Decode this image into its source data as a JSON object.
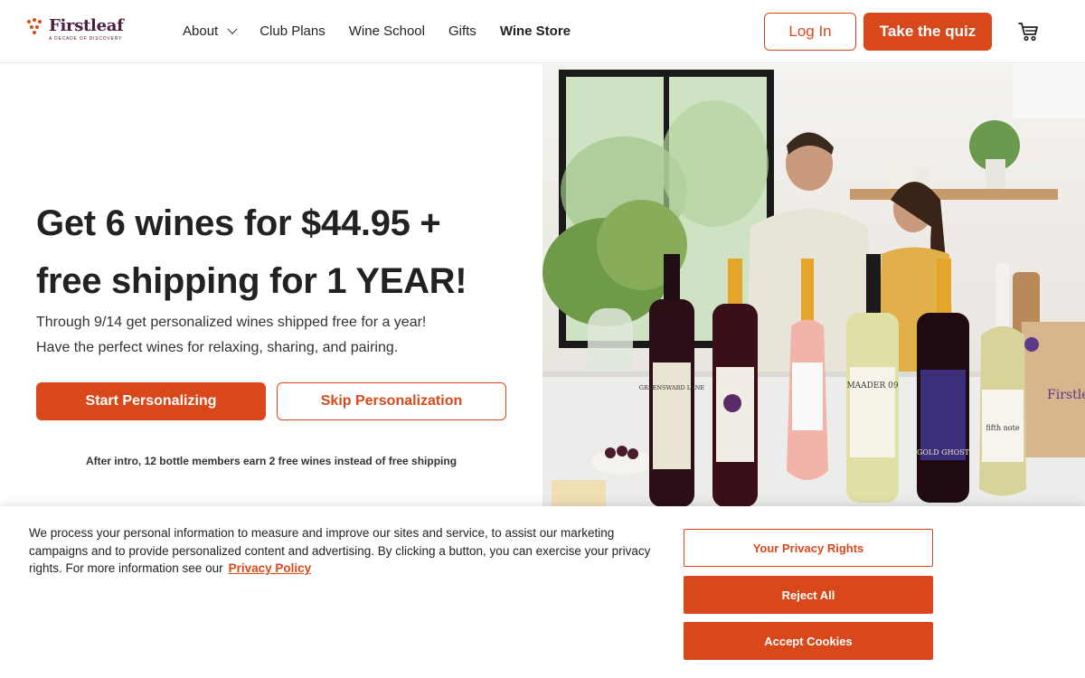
{
  "brand": {
    "name": "Firstleaf",
    "tagline": "A DECADE OF DISCOVERY",
    "accent": "#d9481a",
    "logo_color": "#4b1d3f"
  },
  "nav": {
    "items": [
      {
        "label": "About",
        "has_dropdown": true
      },
      {
        "label": "Club Plans"
      },
      {
        "label": "Wine School"
      },
      {
        "label": "Gifts"
      },
      {
        "label": "Wine Store"
      }
    ],
    "login_label": "Log In",
    "quiz_label": "Take the quiz",
    "cart_icon": "cart-icon"
  },
  "hero": {
    "title_line1": "Get 6 wines for $44.95 +",
    "title_line2": "free shipping for 1 YEAR!",
    "sub_line1": "Through 9/14 get personalized wines shipped free for a year!",
    "sub_line2": "Have the perfect wines for relaxing, sharing, and pairing.",
    "start_label": "Start Personalizing",
    "skip_label": "Skip Personalization",
    "note": "After intro, 12 bottle members earn 2 free wines instead of free shipping",
    "image": {
      "bottle_labels": [
        "GREENSWARD LANE",
        "MAADER 09",
        "GOLD GHOST",
        "fifth note"
      ],
      "box_text": "Firstle"
    }
  },
  "cookie": {
    "text": "We process your personal information to measure and improve our sites and service, to assist our marketing campaigns and to provide personalized content and advertising. By clicking a button, you can exercise your privacy rights. For more information see our",
    "policy_link": "Privacy Policy",
    "privacy_rights_label": "Your Privacy Rights",
    "reject_label": "Reject All",
    "accept_label": "Accept Cookies"
  }
}
